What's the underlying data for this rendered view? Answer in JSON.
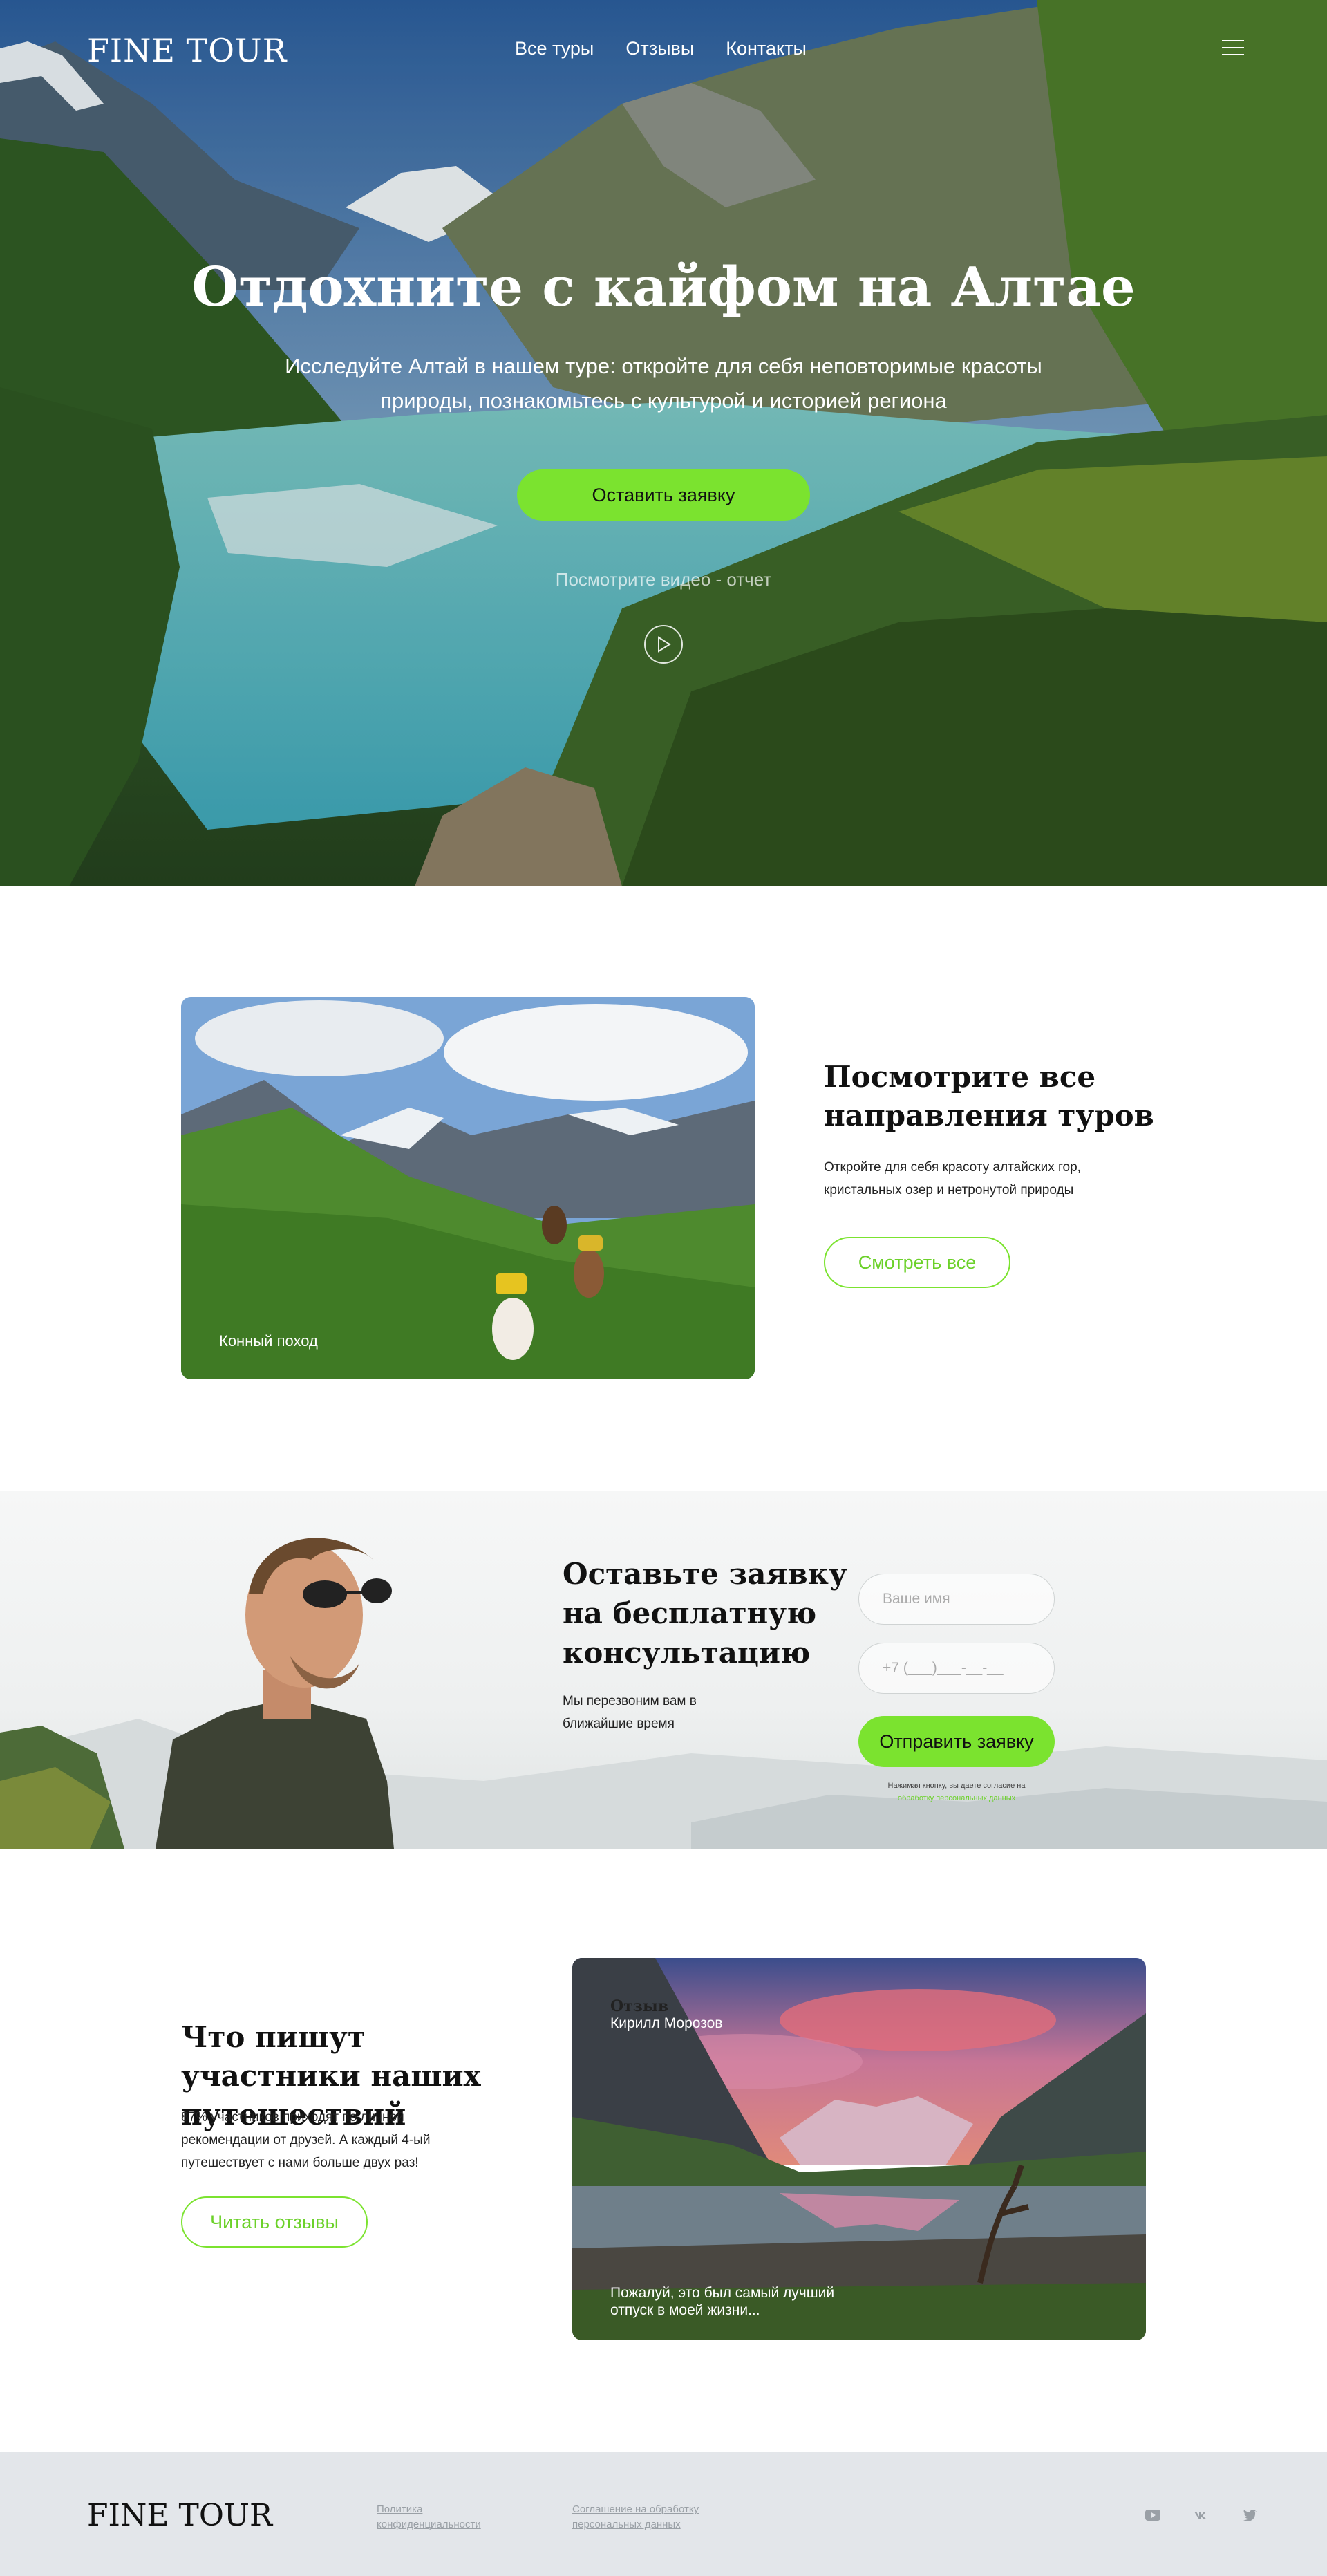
{
  "header": {
    "logo": "FINE TOUR",
    "nav": [
      "Все туры",
      "Отзывы",
      "Контакты"
    ]
  },
  "hero": {
    "title": "Отдохните с кайфом на Алтае",
    "subtitle": "Исследуйте Алтай в нашем туре: откройте для себя неповторимые красоты природы, познакомьтесь с культурой и историей региона",
    "cta": "Оставить заявку",
    "video_label": "Посмотрите видео - отчет"
  },
  "tours": {
    "image_caption": "Конный поход",
    "title": "Посмотрите все направления туров",
    "text": "Откройте для себя красоту алтайских гор, кристальных озер и нетронутой природы",
    "button": "Смотреть все"
  },
  "consult": {
    "title": "Оставьте заявку на бесплатную консультацию",
    "text": "Мы перезвоним вам в ближайшие время",
    "name_placeholder": "Ваше имя",
    "phone_placeholder": "+7 (___)___-__-__",
    "submit": "Отправить заявку",
    "consent_text": "Нажимая кнопку, вы даете согласие на",
    "consent_link": "обработку персональных данных"
  },
  "reviews": {
    "title": "Что пишут участники наших путешествий",
    "text": "87% участников приходят по личной рекомендации от друзей. А каждый 4-ый путешествует с нами больше двух раз!",
    "button": "Читать отзывы",
    "card_label": "Отзыв",
    "card_name": "Кирилл Морозов",
    "card_quote": "Пожалуй, это был самый лучший отпуск в моей жизни..."
  },
  "footer": {
    "logo": "FINE TOUR",
    "privacy": "Политика конфиденциальности",
    "agreement": "Соглашение на обработку персональных данных",
    "social": [
      "youtube-icon",
      "vk-icon",
      "twitter-icon"
    ]
  },
  "colors": {
    "accent": "#7be32f",
    "footer_bg": "#e3e6ea"
  }
}
